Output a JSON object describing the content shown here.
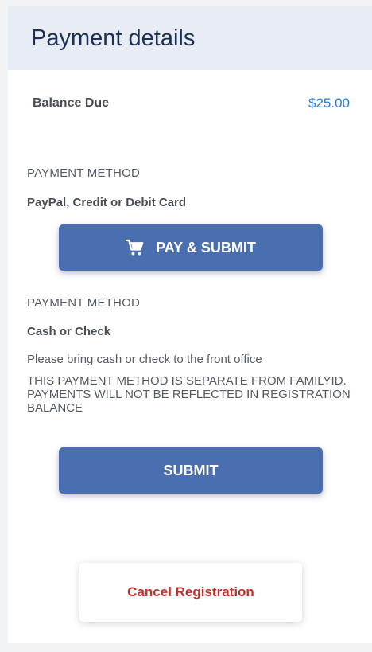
{
  "header": {
    "title": "Payment details"
  },
  "balance": {
    "label": "Balance Due",
    "amount": "$25.00"
  },
  "methods": [
    {
      "heading": "PAYMENT METHOD",
      "name": "PayPal, Credit or Debit Card",
      "button_label": "PAY & SUBMIT",
      "button_icon": "cart-icon"
    },
    {
      "heading": "PAYMENT METHOD",
      "name": "Cash or Check",
      "note": "Please bring cash or check to the front office",
      "warning": "THIS PAYMENT METHOD IS SEPARATE FROM FAMILYID. PAYMENTS WILL NOT BE REFLECTED IN REGISTRATION BALANCE",
      "button_label": "SUBMIT"
    }
  ],
  "cancel": {
    "label": "Cancel Registration"
  },
  "colors": {
    "primary_button": "#4a6fb0",
    "amount": "#2c7ad8",
    "cancel_text": "#c0302c",
    "header_bg": "#e8edf5"
  }
}
